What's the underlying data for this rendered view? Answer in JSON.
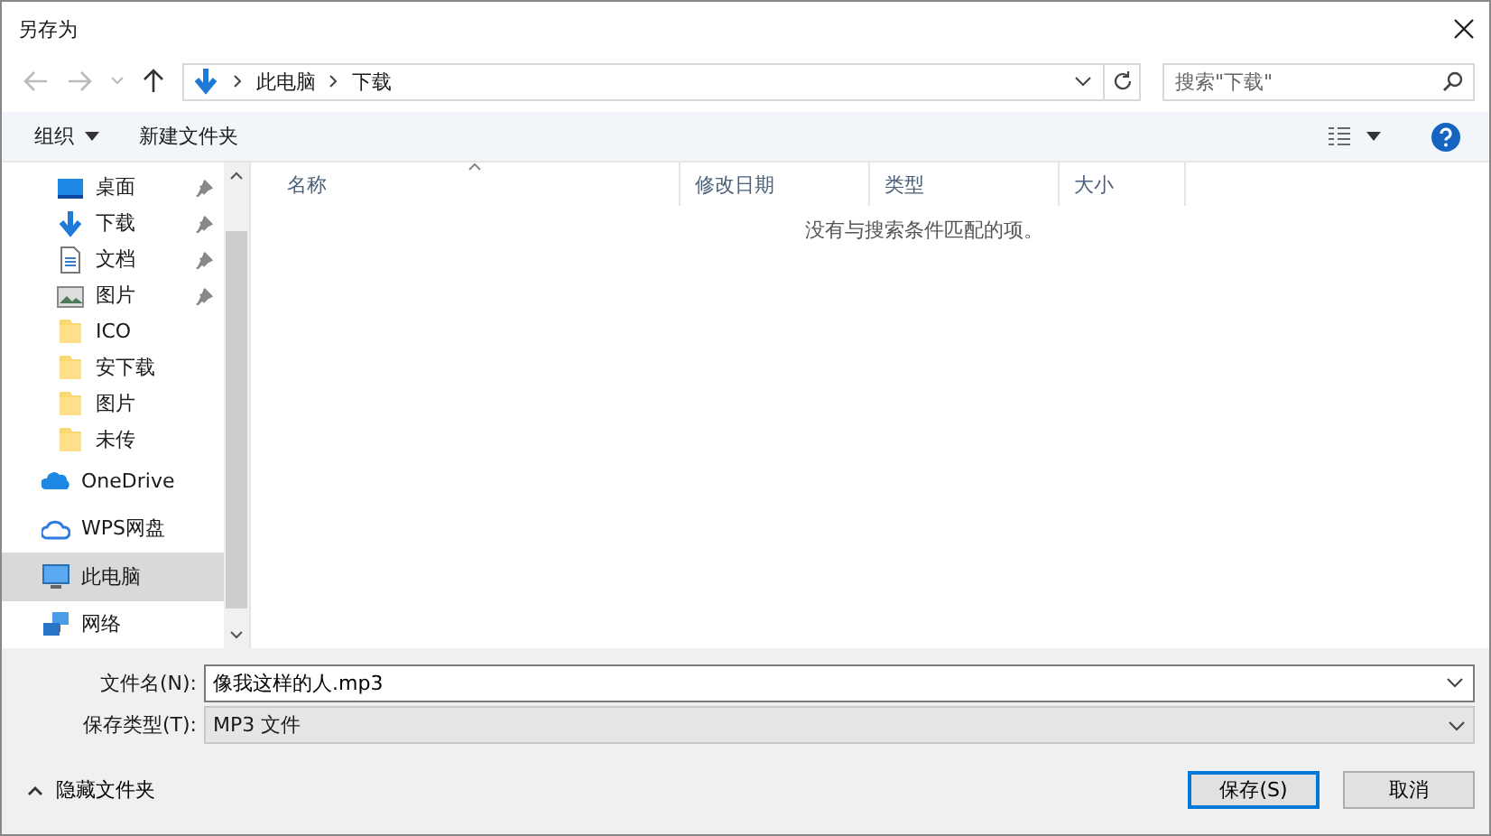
{
  "window": {
    "title": "另存为"
  },
  "nav": {
    "path": [
      "此电脑",
      "下载"
    ],
    "search": {
      "placeholder": "搜索\"下载\""
    }
  },
  "toolbar": {
    "organize": "组织",
    "new_folder": "新建文件夹"
  },
  "sidebar": {
    "quick_access": [
      {
        "label": "桌面",
        "kind": "desktop",
        "pinned": true
      },
      {
        "label": "下载",
        "kind": "download",
        "pinned": true
      },
      {
        "label": "文档",
        "kind": "document",
        "pinned": true
      },
      {
        "label": "图片",
        "kind": "image",
        "pinned": true
      },
      {
        "label": "ICO",
        "kind": "folder",
        "pinned": false
      },
      {
        "label": "安下载",
        "kind": "folder",
        "pinned": false
      },
      {
        "label": "图片",
        "kind": "folder",
        "pinned": false
      },
      {
        "label": "未传",
        "kind": "folder",
        "pinned": false
      }
    ],
    "locations": [
      {
        "label": "OneDrive",
        "kind": "cloud",
        "selected": false
      },
      {
        "label": "WPS网盘",
        "kind": "webdrive",
        "selected": false
      },
      {
        "label": "此电脑",
        "kind": "computer",
        "selected": true
      },
      {
        "label": "网络",
        "kind": "network",
        "selected": false
      }
    ]
  },
  "columns": [
    "名称",
    "修改日期",
    "类型",
    "大小"
  ],
  "empty_message": "没有与搜索条件匹配的项。",
  "form": {
    "filename_label": "文件名(N):",
    "filename": "像我这样的人.mp3",
    "type_label": "保存类型(T):",
    "type": "MP3 文件"
  },
  "hide_folders": "隐藏文件夹",
  "buttons": [
    {
      "label": "保存(S)",
      "default": true
    },
    {
      "label": "取消",
      "default": false
    }
  ]
}
